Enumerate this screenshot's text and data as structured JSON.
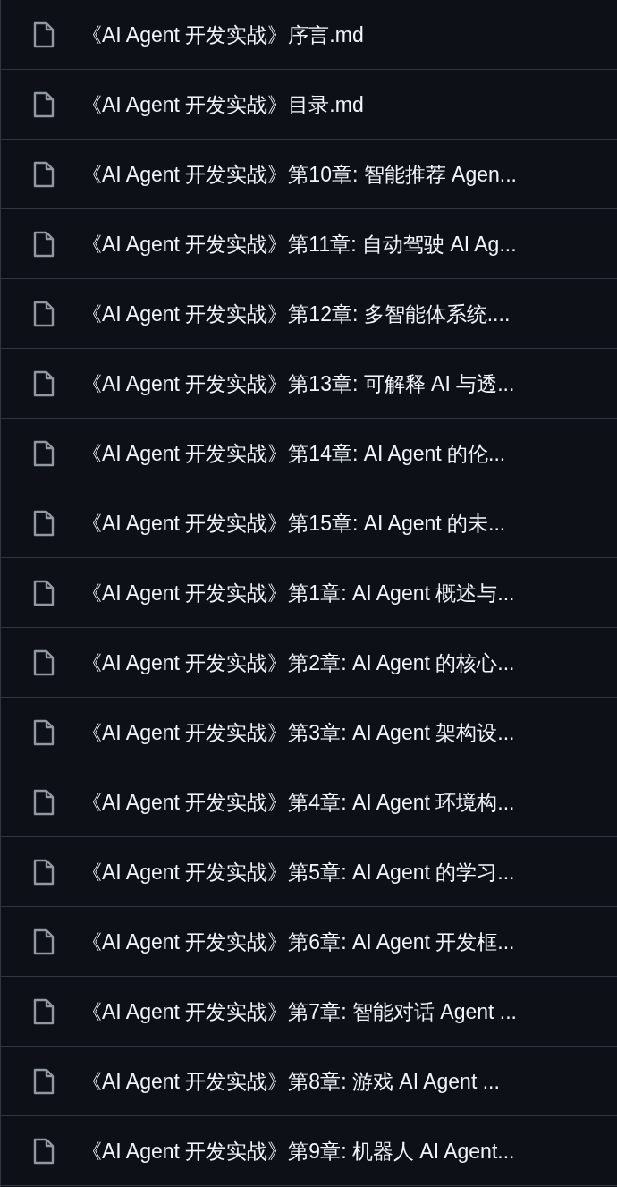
{
  "files": [
    {
      "name": "《AI Agent 开发实战》序言.md"
    },
    {
      "name": "《AI Agent 开发实战》目录.md"
    },
    {
      "name": "《AI Agent 开发实战》第10章: 智能推荐 Agen..."
    },
    {
      "name": "《AI Agent 开发实战》第11章: 自动驾驶 AI Ag..."
    },
    {
      "name": "《AI Agent 开发实战》第12章: 多智能体系统...."
    },
    {
      "name": "《AI Agent 开发实战》第13章: 可解释 AI 与透..."
    },
    {
      "name": "《AI Agent 开发实战》第14章: AI Agent 的伦..."
    },
    {
      "name": "《AI Agent 开发实战》第15章: AI Agent 的未..."
    },
    {
      "name": "《AI Agent 开发实战》第1章: AI Agent 概述与..."
    },
    {
      "name": "《AI Agent 开发实战》第2章: AI Agent 的核心..."
    },
    {
      "name": "《AI Agent 开发实战》第3章: AI Agent 架构设..."
    },
    {
      "name": "《AI Agent 开发实战》第4章: AI Agent 环境构..."
    },
    {
      "name": "《AI Agent 开发实战》第5章: AI Agent 的学习..."
    },
    {
      "name": "《AI Agent 开发实战》第6章: AI Agent 开发框..."
    },
    {
      "name": "《AI Agent 开发实战》第7章: 智能对话 Agent ..."
    },
    {
      "name": "《AI Agent 开发实战》第8章: 游戏 AI Agent ..."
    },
    {
      "name": "《AI Agent 开发实战》第9章: 机器人 AI Agent..."
    }
  ]
}
